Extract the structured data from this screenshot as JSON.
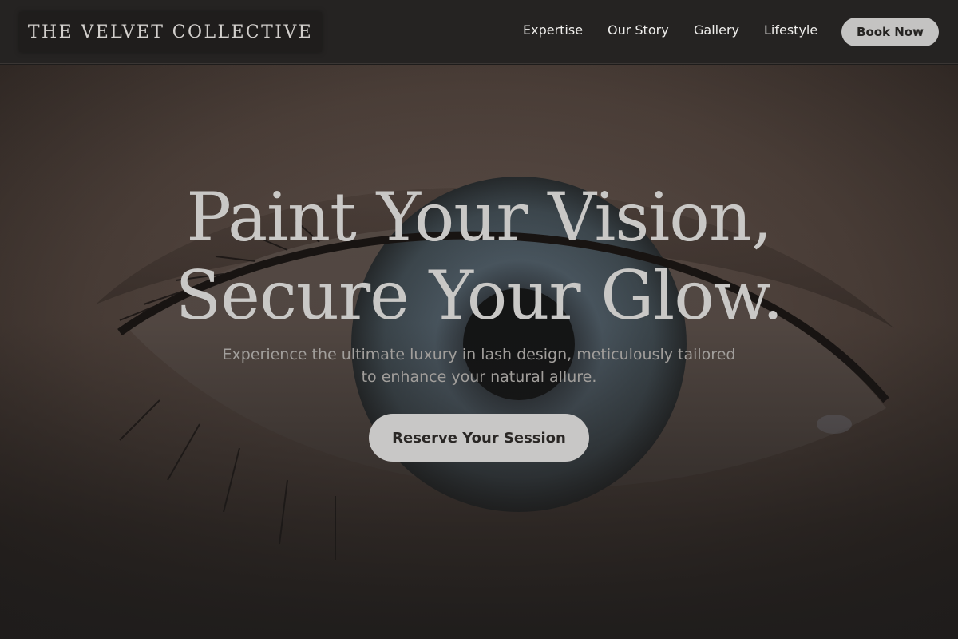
{
  "header": {
    "logo_text": "THE VELVET COLLECTIVE",
    "nav": [
      {
        "label": "Expertise"
      },
      {
        "label": "Our Story"
      },
      {
        "label": "Gallery"
      },
      {
        "label": "Lifestyle"
      }
    ],
    "cta_label": "Book Now"
  },
  "hero": {
    "headline_line1": "Paint Your Vision,",
    "headline_line2": "Secure Your Glow.",
    "subtext_line1": "Experience the ultimate luxury in lash design, meticulously tailored",
    "subtext_line2": "to enhance your natural allure.",
    "cta_label": "Reserve Your Session",
    "background_image": "close-up-eye-photo"
  },
  "colors": {
    "header_bg": "#252322",
    "button_bg": "#c4c3c2",
    "headline": "#c9c8c6",
    "subtext": "#a19e9b"
  }
}
